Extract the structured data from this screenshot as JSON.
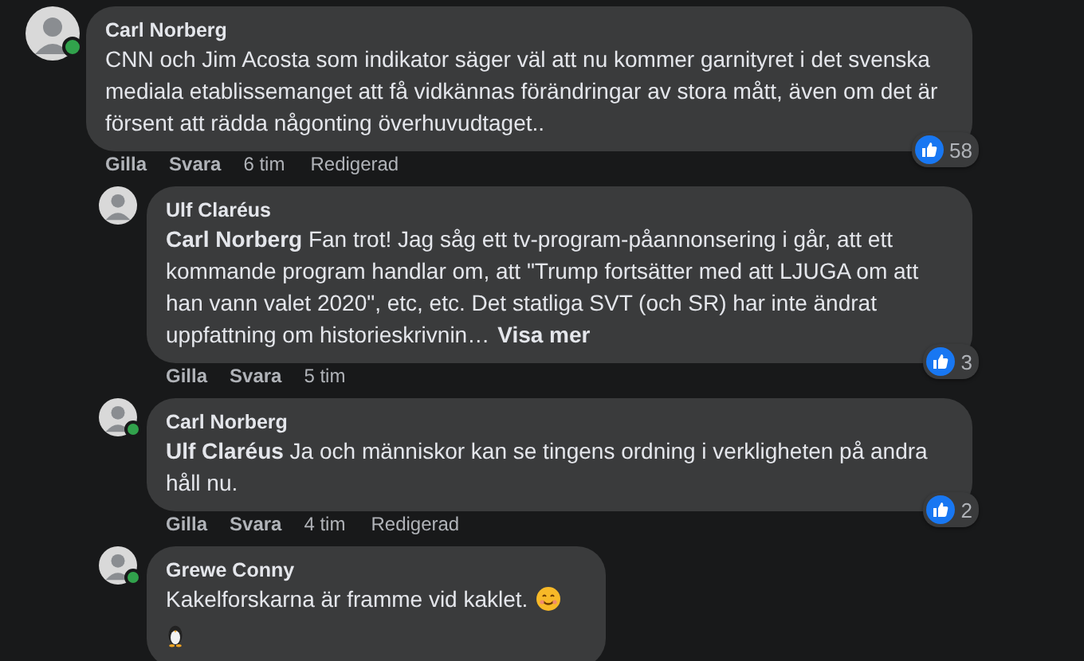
{
  "comments": [
    {
      "author": "Carl Norberg",
      "online": true,
      "text": "CNN och Jim Acosta som indikator säger väl att nu kommer garnityret i det svenska mediala etablissemanget att få vidkännas förändringar av stora mått, även om det är försent att rädda någonting överhuvudtaget..",
      "actions": [
        "Gilla",
        "Svara"
      ],
      "time": "6 tim",
      "edited": "Redigerad",
      "reactions": "58",
      "children": [
        {
          "author": "Ulf Claréus",
          "online": false,
          "text": "**Carl Norberg** Fan trot! Jag såg ett tv-program-påannonsering i går, att ett kommande program handlar om, att \"Trump fortsätter med att LJUGA om att han vann valet 2020\", etc, etc. Det statliga SVT (och SR) har inte ändrat uppfattning om historieskrivnin…",
          "more": "Visa mer",
          "actions": [
            "Gilla",
            "Svara"
          ],
          "time": "5 tim",
          "reactions": "3"
        },
        {
          "author": "Carl Norberg",
          "online": true,
          "text": "**Ulf Claréus** Ja och människor kan se tingens ordning i verkligheten på andra håll nu.",
          "actions": [
            "Gilla",
            "Svara"
          ],
          "time": "4 tim",
          "edited": "Redigerad",
          "reactions": "2"
        },
        {
          "author": "Grewe Conny",
          "online": true,
          "text": "Kakelforskarna är framme vid kaklet.",
          "emoji": {
            "kind": "smiley"
          },
          "sticker": {
            "kind": "penguin"
          }
        }
      ]
    }
  ]
}
